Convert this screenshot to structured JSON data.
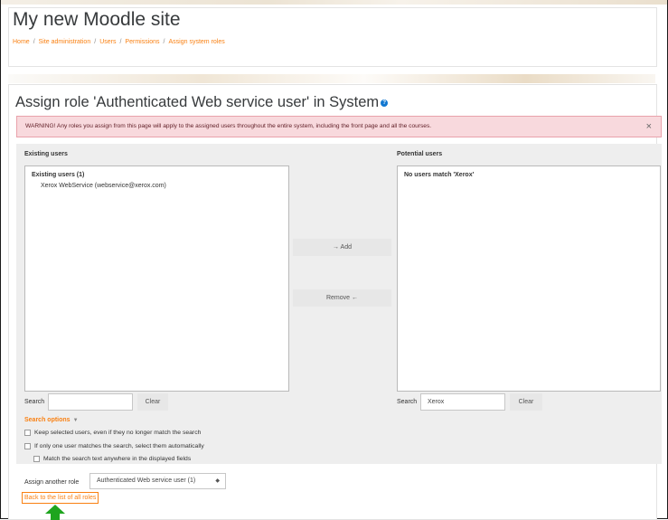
{
  "site": {
    "title": "My new Moodle site"
  },
  "breadcrumb": [
    "Home",
    "Site administration",
    "Users",
    "Permissions",
    "Assign system roles"
  ],
  "breadcrumb_separator": "/",
  "page": {
    "heading": "Assign role 'Authenticated Web service user' in System",
    "help_icon": "question-circle-icon"
  },
  "alert": {
    "text": "WARNING! Any roles you assign from this page will apply to the assigned users throughout the entire system, including the front page and all the courses.",
    "close": "×"
  },
  "existing": {
    "header": "Existing users",
    "group_label": "Existing users (1)",
    "options": [
      "Xerox WebService (webservice@xerox.com)"
    ],
    "search_label": "Search",
    "search_value": "",
    "clear_label": "Clear"
  },
  "potential": {
    "header": "Potential users",
    "group_label": "No users match 'Xerox'",
    "search_label": "Search",
    "search_value": "Xerox",
    "clear_label": "Clear"
  },
  "buttons": {
    "add": "→ Add",
    "remove": "Remove ←"
  },
  "search_options": {
    "toggle_label": "Search options",
    "checkboxes": [
      "Keep selected users, even if they no longer match the search",
      "If only one user matches the search, select them automatically",
      "Match the search text anywhere in the displayed fields"
    ]
  },
  "assign_another": {
    "label": "Assign another role",
    "selected": "Authenticated Web service user (1)"
  },
  "back_link": "Back to the list of all roles",
  "colors": {
    "accent": "#f98012",
    "alert_bg": "#f8d9dd",
    "arrow": "#1ea51e"
  }
}
